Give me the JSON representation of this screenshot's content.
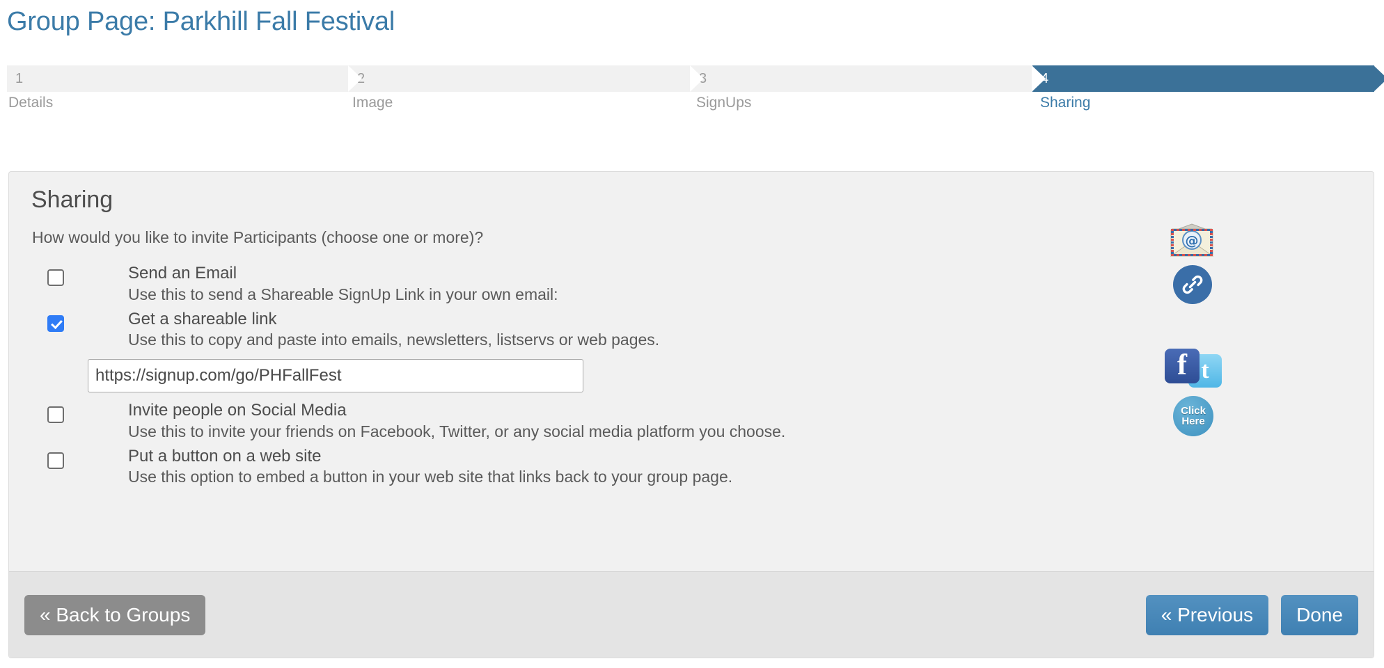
{
  "page": {
    "title": "Group Page: Parkhill Fall Festival",
    "title_color": "#3b7ba8"
  },
  "wizard": {
    "active_color": "#3b7198",
    "inactive_bg": "#f1f1f1",
    "steps": [
      {
        "number": "1",
        "label": "Details",
        "active": false
      },
      {
        "number": "2",
        "label": "Image",
        "active": false
      },
      {
        "number": "3",
        "label": "SignUps",
        "active": false
      },
      {
        "number": "4",
        "label": "Sharing",
        "active": true
      }
    ]
  },
  "panel": {
    "heading": "Sharing",
    "question": "How would you like to invite Participants (choose one or more)?",
    "options": [
      {
        "title": "Send an Email",
        "description": "Use this to send a Shareable SignUp Link in your own email:",
        "checked": false,
        "icon": "envelope-at-icon"
      },
      {
        "title": "Get a shareable link",
        "description": "Use this to copy and paste into emails, newsletters, listservs or web pages.",
        "checked": true,
        "icon": "link-circle-icon"
      },
      {
        "title": "Invite people on Social Media",
        "description": "Use this to invite your friends on Facebook, Twitter, or any social media platform you choose.",
        "checked": false,
        "icon": "facebook-twitter-icon"
      },
      {
        "title": "Put a button on a web site",
        "description": "Use this option to embed a button in your web site that links back to your group page.",
        "checked": false,
        "icon": "click-here-badge-icon"
      }
    ],
    "share_link": {
      "value": "https://signup.com/go/PHFallFest",
      "placeholder": "https://signup.com/go/"
    },
    "icons": {
      "facebook_glyph": "f",
      "twitter_glyph": "t",
      "click_line1": "Click",
      "click_line2": "Here"
    }
  },
  "footer": {
    "back_label": "« Back to Groups",
    "previous_label": "« Previous",
    "done_label": "Done",
    "grey": "#8c8c8c",
    "blue": "#4385b6"
  }
}
